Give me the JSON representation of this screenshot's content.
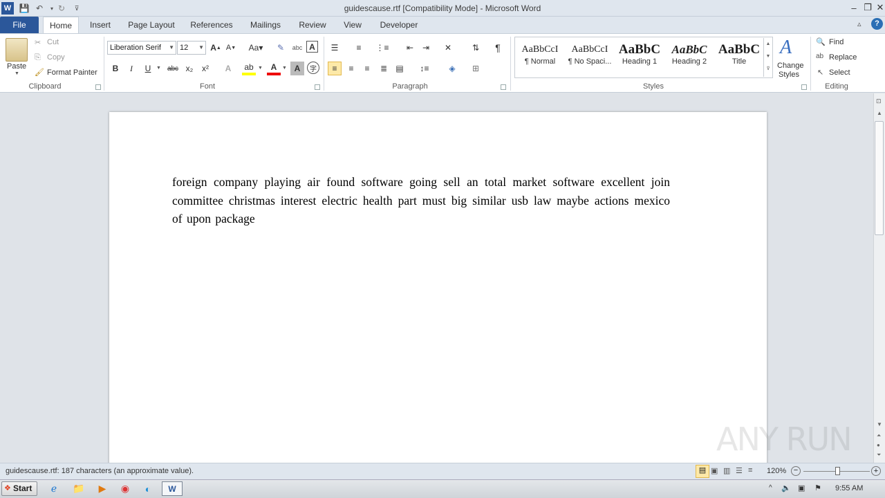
{
  "window": {
    "title": "guidescause.rtf [Compatibility Mode] - Microsoft Word",
    "controls": {
      "minimize": "–",
      "restore": "❐",
      "close": "✕"
    }
  },
  "tabs": [
    "File",
    "Home",
    "Insert",
    "Page Layout",
    "References",
    "Mailings",
    "Review",
    "View",
    "Developer"
  ],
  "clipboard": {
    "paste_label": "Paste",
    "cut_label": "Cut",
    "copy_label": "Copy",
    "format_painter_label": "Format Painter",
    "group_label": "Clipboard"
  },
  "font": {
    "family": "Liberation Serif",
    "size": "12",
    "group_label": "Font",
    "bold": "B",
    "italic": "I",
    "underline": "U",
    "strike": "abc",
    "subscript": "x₂",
    "superscript": "x²"
  },
  "paragraph": {
    "group_label": "Paragraph",
    "pilcrow": "¶"
  },
  "styles": {
    "group_label": "Styles",
    "tiles": [
      {
        "sample": "AaBbCcI",
        "name": "¶ Normal"
      },
      {
        "sample": "AaBbCcI",
        "name": "¶ No Spaci..."
      },
      {
        "sample": "AaBbC",
        "name": "Heading 1"
      },
      {
        "sample": "AaBbC",
        "name": "Heading 2"
      },
      {
        "sample": "AaBbC",
        "name": "Title"
      }
    ],
    "change_styles_line1": "Change",
    "change_styles_line2": "Styles"
  },
  "editing": {
    "group_label": "Editing",
    "find_label": "Find",
    "replace_label": "Replace",
    "select_label": "Select"
  },
  "document": {
    "text": "foreign company playing air found software going sell an total market software excellent join committee christmas interest electric health part must big similar usb law maybe actions mexico of upon package"
  },
  "status": {
    "text": "guidescause.rtf: 187 characters (an approximate value).",
    "zoom": "120%"
  },
  "taskbar": {
    "start_label": "Start",
    "clock": "9:55 AM"
  },
  "watermark": "ANY RUN",
  "colors": {
    "file_tab": "#2b579a",
    "accent": "#2b579a"
  }
}
